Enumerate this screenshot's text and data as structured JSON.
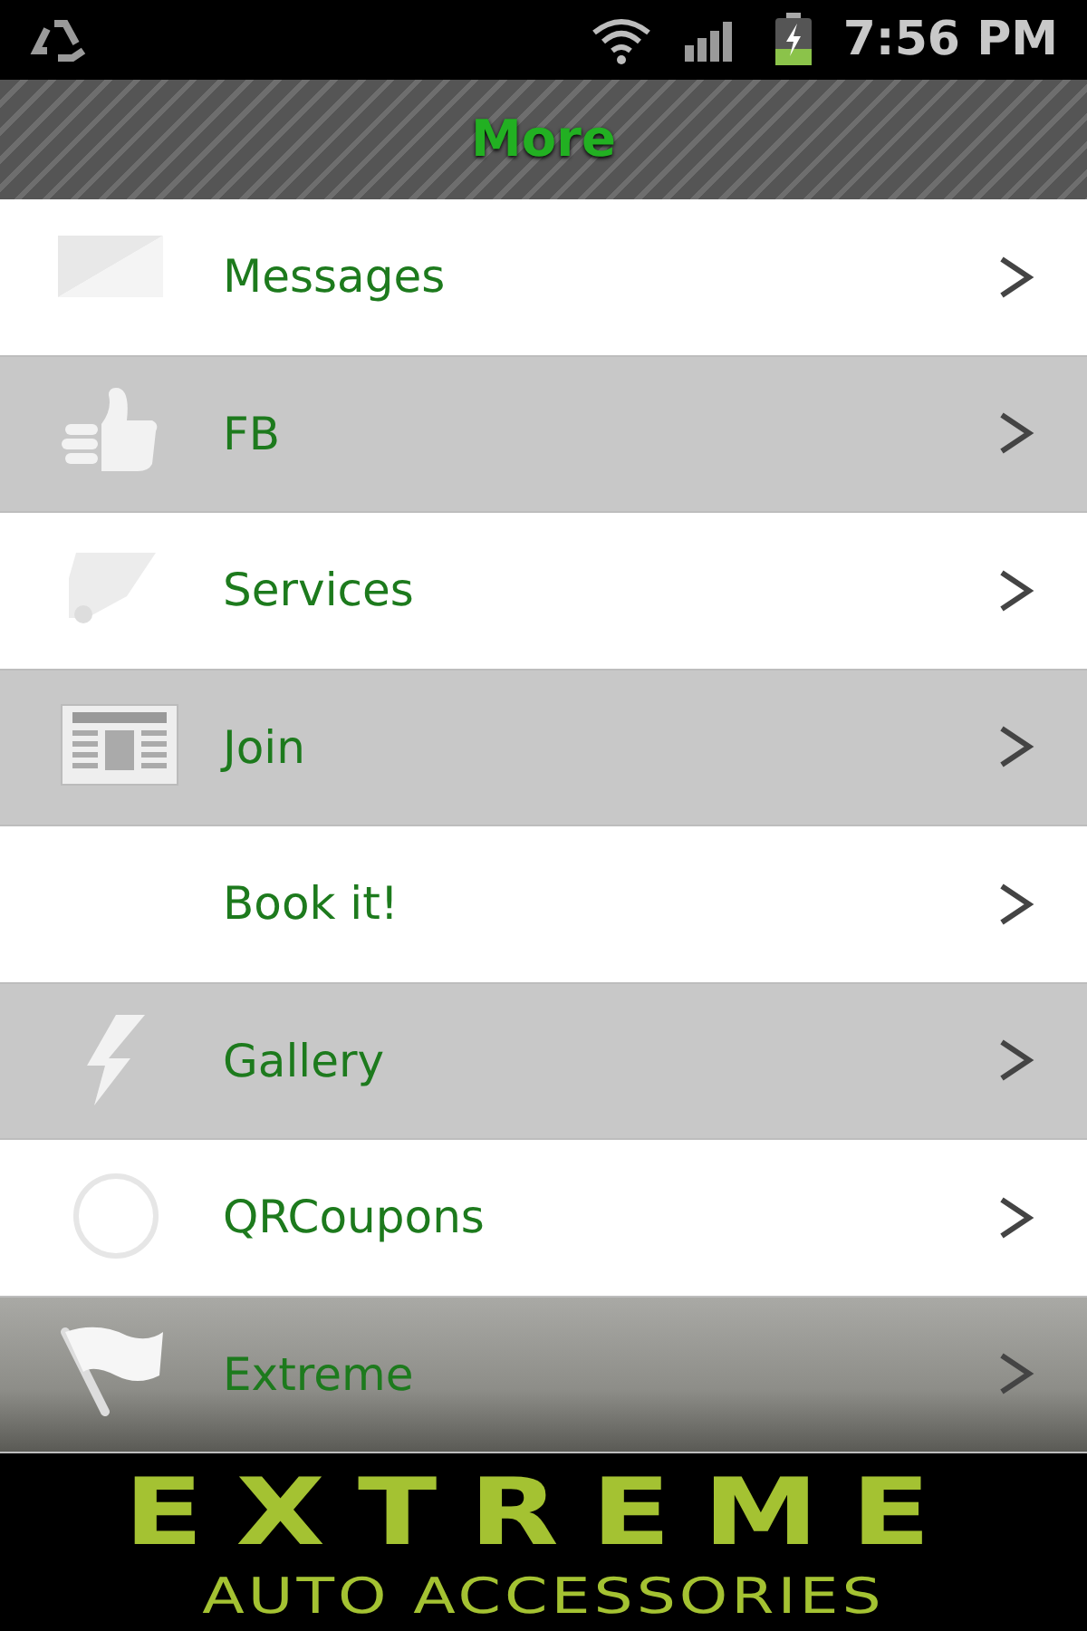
{
  "status_bar": {
    "time": "7:56 PM"
  },
  "header": {
    "title": "More"
  },
  "menu": [
    {
      "label": "Messages"
    },
    {
      "label": "FB"
    },
    {
      "label": "Services"
    },
    {
      "label": "Join"
    },
    {
      "label": "Book it!"
    },
    {
      "label": "Gallery"
    },
    {
      "label": "QRCoupons"
    },
    {
      "label": "Extreme"
    }
  ],
  "banner": {
    "logo_line_1": "EXTREME",
    "logo_line_2": "AUTO ACCESSORIES"
  }
}
